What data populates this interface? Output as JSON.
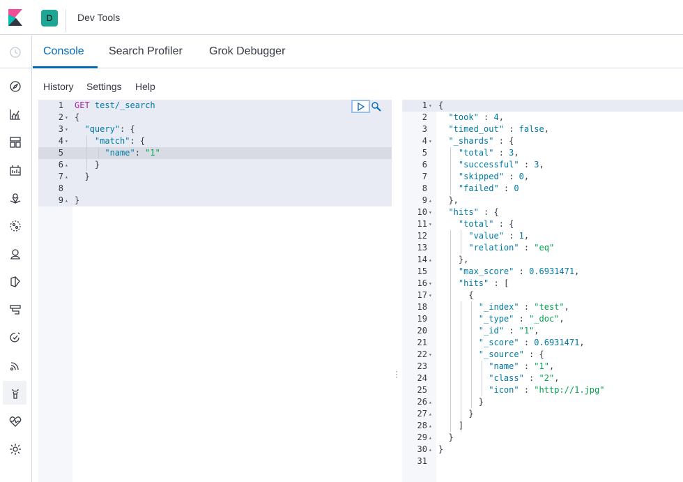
{
  "header": {
    "logo_icon": "kibana-logo-icon",
    "space_initial": "D",
    "space_color": "#1ea593",
    "app_title": "Dev Tools"
  },
  "tabs": [
    {
      "label": "Console",
      "active": true
    },
    {
      "label": "Search Profiler",
      "active": false
    },
    {
      "label": "Grok Debugger",
      "active": false
    }
  ],
  "menu": {
    "history": "History",
    "settings": "Settings",
    "help": "Help"
  },
  "nav_icons": [
    "clock-icon",
    "discover-icon",
    "visualize-icon",
    "dashboard-icon",
    "canvas-icon",
    "maps-icon",
    "ml-icon",
    "graph-icon",
    "apm-icon",
    "logs-icon",
    "uptime-icon",
    "siem-icon",
    "dev-tools-icon",
    "monitoring-icon",
    "management-icon"
  ],
  "accent_color": "#006bb4",
  "request": {
    "lines": [
      {
        "n": "1",
        "fold": "",
        "parts": [
          [
            "kw",
            "GET"
          ],
          [
            "p",
            " "
          ],
          [
            "url",
            "test/_search"
          ]
        ]
      },
      {
        "n": "2",
        "fold": "▾",
        "parts": [
          [
            "p",
            "{"
          ]
        ]
      },
      {
        "n": "3",
        "fold": "▾",
        "parts": [
          [
            "p",
            "  "
          ],
          [
            "key",
            "\"query\""
          ],
          [
            "p",
            ": {"
          ]
        ]
      },
      {
        "n": "4",
        "fold": "▾",
        "parts": [
          [
            "p",
            "    "
          ],
          [
            "key",
            "\"match\""
          ],
          [
            "p",
            ": {"
          ]
        ]
      },
      {
        "n": "5",
        "fold": "",
        "parts": [
          [
            "p",
            "      "
          ],
          [
            "key",
            "\"name\""
          ],
          [
            "p",
            ": "
          ],
          [
            "str",
            "\"1\""
          ]
        ]
      },
      {
        "n": "6",
        "fold": "▴",
        "parts": [
          [
            "p",
            "    }"
          ]
        ]
      },
      {
        "n": "7",
        "fold": "▴",
        "parts": [
          [
            "p",
            "  }"
          ]
        ]
      },
      {
        "n": "8",
        "fold": "",
        "parts": [
          [
            "p",
            ""
          ]
        ]
      },
      {
        "n": "9",
        "fold": "▴",
        "parts": [
          [
            "p",
            "}"
          ]
        ]
      }
    ]
  },
  "response": {
    "lines": [
      {
        "n": "1",
        "fold": "▾",
        "parts": [
          [
            "p",
            "{"
          ]
        ]
      },
      {
        "n": "2",
        "fold": "",
        "parts": [
          [
            "p",
            "  "
          ],
          [
            "key",
            "\"took\""
          ],
          [
            "p",
            " : "
          ],
          [
            "num",
            "4"
          ],
          [
            "p",
            ","
          ]
        ]
      },
      {
        "n": "3",
        "fold": "",
        "parts": [
          [
            "p",
            "  "
          ],
          [
            "key",
            "\"timed_out\""
          ],
          [
            "p",
            " : "
          ],
          [
            "bool",
            "false"
          ],
          [
            "p",
            ","
          ]
        ]
      },
      {
        "n": "4",
        "fold": "▾",
        "parts": [
          [
            "p",
            "  "
          ],
          [
            "key",
            "\"_shards\""
          ],
          [
            "p",
            " : {"
          ]
        ]
      },
      {
        "n": "5",
        "fold": "",
        "parts": [
          [
            "p",
            "    "
          ],
          [
            "key",
            "\"total\""
          ],
          [
            "p",
            " : "
          ],
          [
            "num",
            "3"
          ],
          [
            "p",
            ","
          ]
        ]
      },
      {
        "n": "6",
        "fold": "",
        "parts": [
          [
            "p",
            "    "
          ],
          [
            "key",
            "\"successful\""
          ],
          [
            "p",
            " : "
          ],
          [
            "num",
            "3"
          ],
          [
            "p",
            ","
          ]
        ]
      },
      {
        "n": "7",
        "fold": "",
        "parts": [
          [
            "p",
            "    "
          ],
          [
            "key",
            "\"skipped\""
          ],
          [
            "p",
            " : "
          ],
          [
            "num",
            "0"
          ],
          [
            "p",
            ","
          ]
        ]
      },
      {
        "n": "8",
        "fold": "",
        "parts": [
          [
            "p",
            "    "
          ],
          [
            "key",
            "\"failed\""
          ],
          [
            "p",
            " : "
          ],
          [
            "num",
            "0"
          ]
        ]
      },
      {
        "n": "9",
        "fold": "▴",
        "parts": [
          [
            "p",
            "  },"
          ]
        ]
      },
      {
        "n": "10",
        "fold": "▾",
        "parts": [
          [
            "p",
            "  "
          ],
          [
            "key",
            "\"hits\""
          ],
          [
            "p",
            " : {"
          ]
        ]
      },
      {
        "n": "11",
        "fold": "▾",
        "parts": [
          [
            "p",
            "    "
          ],
          [
            "key",
            "\"total\""
          ],
          [
            "p",
            " : {"
          ]
        ]
      },
      {
        "n": "12",
        "fold": "",
        "parts": [
          [
            "p",
            "      "
          ],
          [
            "key",
            "\"value\""
          ],
          [
            "p",
            " : "
          ],
          [
            "num",
            "1"
          ],
          [
            "p",
            ","
          ]
        ]
      },
      {
        "n": "13",
        "fold": "",
        "parts": [
          [
            "p",
            "      "
          ],
          [
            "key",
            "\"relation\""
          ],
          [
            "p",
            " : "
          ],
          [
            "str",
            "\"eq\""
          ]
        ]
      },
      {
        "n": "14",
        "fold": "▴",
        "parts": [
          [
            "p",
            "    },"
          ]
        ]
      },
      {
        "n": "15",
        "fold": "",
        "parts": [
          [
            "p",
            "    "
          ],
          [
            "key",
            "\"max_score\""
          ],
          [
            "p",
            " : "
          ],
          [
            "num",
            "0.6931471"
          ],
          [
            "p",
            ","
          ]
        ]
      },
      {
        "n": "16",
        "fold": "▾",
        "parts": [
          [
            "p",
            "    "
          ],
          [
            "key",
            "\"hits\""
          ],
          [
            "p",
            " : ["
          ]
        ]
      },
      {
        "n": "17",
        "fold": "▾",
        "parts": [
          [
            "p",
            "      {"
          ]
        ]
      },
      {
        "n": "18",
        "fold": "",
        "parts": [
          [
            "p",
            "        "
          ],
          [
            "key",
            "\"_index\""
          ],
          [
            "p",
            " : "
          ],
          [
            "str",
            "\"test\""
          ],
          [
            "p",
            ","
          ]
        ]
      },
      {
        "n": "19",
        "fold": "",
        "parts": [
          [
            "p",
            "        "
          ],
          [
            "key",
            "\"_type\""
          ],
          [
            "p",
            " : "
          ],
          [
            "str",
            "\"_doc\""
          ],
          [
            "p",
            ","
          ]
        ]
      },
      {
        "n": "20",
        "fold": "",
        "parts": [
          [
            "p",
            "        "
          ],
          [
            "key",
            "\"_id\""
          ],
          [
            "p",
            " : "
          ],
          [
            "str",
            "\"1\""
          ],
          [
            "p",
            ","
          ]
        ]
      },
      {
        "n": "21",
        "fold": "",
        "parts": [
          [
            "p",
            "        "
          ],
          [
            "key",
            "\"_score\""
          ],
          [
            "p",
            " : "
          ],
          [
            "num",
            "0.6931471"
          ],
          [
            "p",
            ","
          ]
        ]
      },
      {
        "n": "22",
        "fold": "▾",
        "parts": [
          [
            "p",
            "        "
          ],
          [
            "key",
            "\"_source\""
          ],
          [
            "p",
            " : {"
          ]
        ]
      },
      {
        "n": "23",
        "fold": "",
        "parts": [
          [
            "p",
            "          "
          ],
          [
            "key",
            "\"name\""
          ],
          [
            "p",
            " : "
          ],
          [
            "str",
            "\"1\""
          ],
          [
            "p",
            ","
          ]
        ]
      },
      {
        "n": "24",
        "fold": "",
        "parts": [
          [
            "p",
            "          "
          ],
          [
            "key",
            "\"class\""
          ],
          [
            "p",
            " : "
          ],
          [
            "str",
            "\"2\""
          ],
          [
            "p",
            ","
          ]
        ]
      },
      {
        "n": "25",
        "fold": "",
        "parts": [
          [
            "p",
            "          "
          ],
          [
            "key",
            "\"icon\""
          ],
          [
            "p",
            " : "
          ],
          [
            "str",
            "\"http://1.jpg\""
          ]
        ]
      },
      {
        "n": "26",
        "fold": "▴",
        "parts": [
          [
            "p",
            "        }"
          ]
        ]
      },
      {
        "n": "27",
        "fold": "▴",
        "parts": [
          [
            "p",
            "      }"
          ]
        ]
      },
      {
        "n": "28",
        "fold": "▴",
        "parts": [
          [
            "p",
            "    ]"
          ]
        ]
      },
      {
        "n": "29",
        "fold": "▴",
        "parts": [
          [
            "p",
            "  }"
          ]
        ]
      },
      {
        "n": "30",
        "fold": "▴",
        "parts": [
          [
            "p",
            "}"
          ]
        ]
      },
      {
        "n": "31",
        "fold": "",
        "parts": [
          [
            "p",
            ""
          ]
        ]
      }
    ]
  }
}
